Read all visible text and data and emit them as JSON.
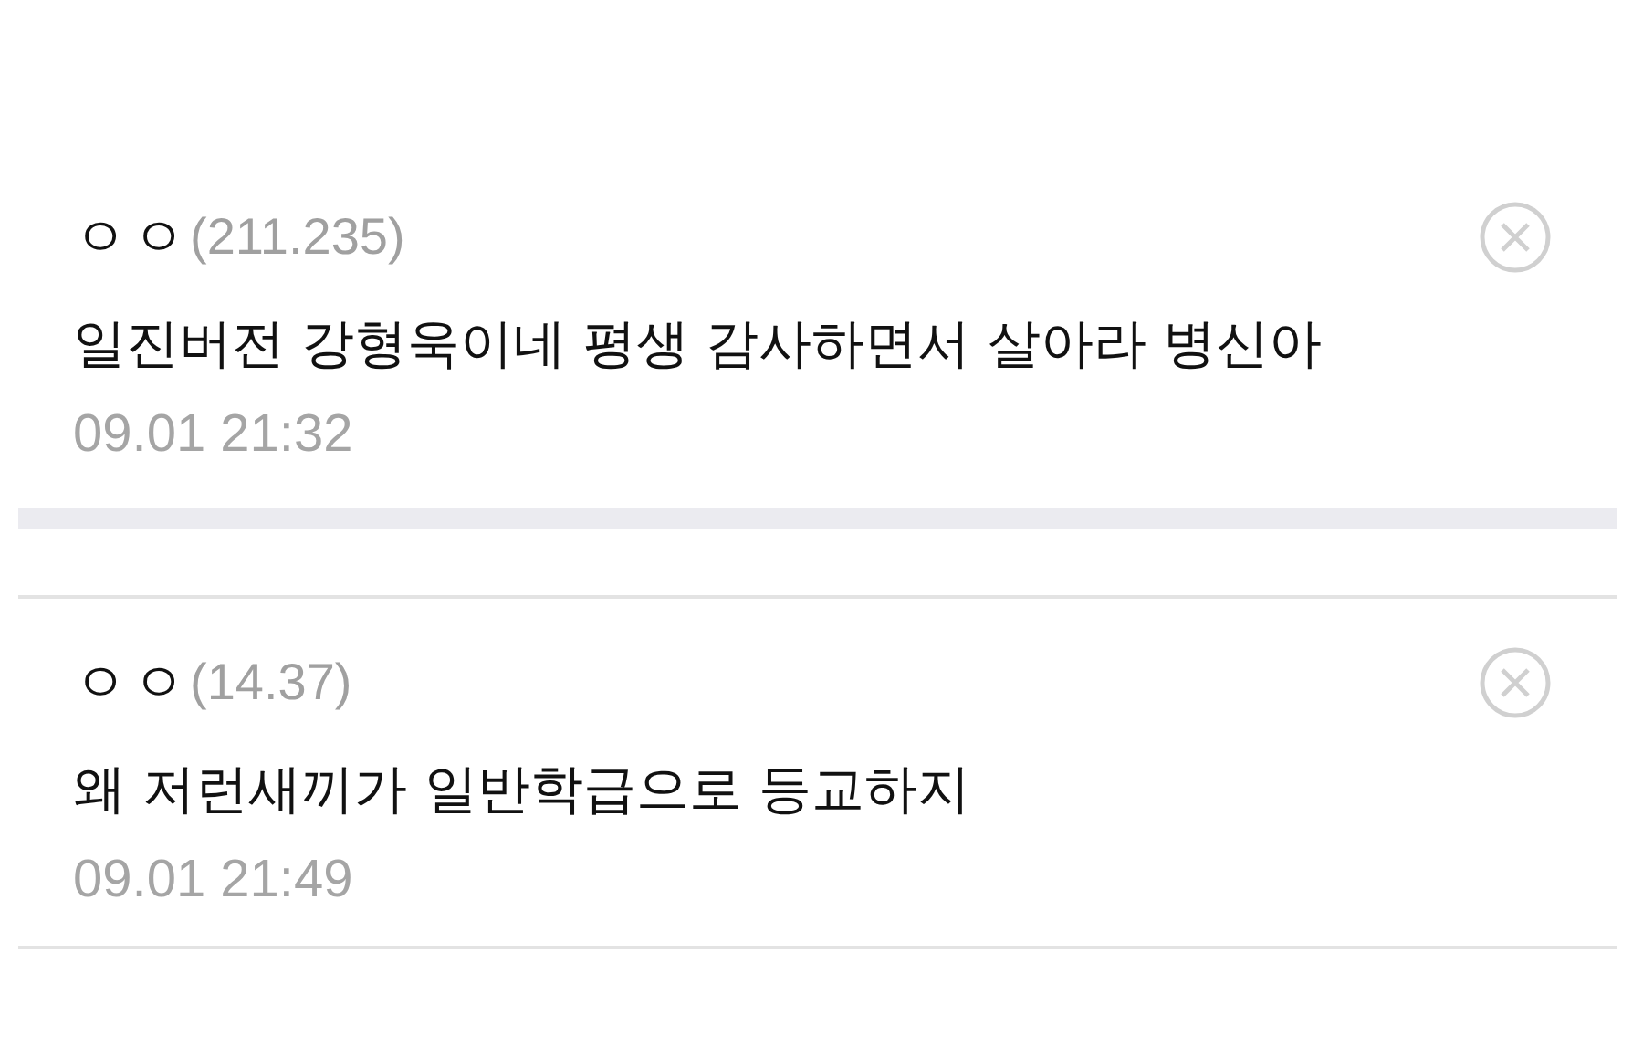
{
  "comments": [
    {
      "nickname": "ㅇㅇ",
      "ip": "(211.235)",
      "text": "일진버전 강형욱이네 평생 감사하면서 살아라 병신아",
      "time": "09.01 21:32"
    },
    {
      "nickname": "ㅇㅇ",
      "ip": "(14.37)",
      "text": "왜 저런새끼가 일반학급으로 등교하지",
      "time": "09.01 21:49"
    }
  ]
}
